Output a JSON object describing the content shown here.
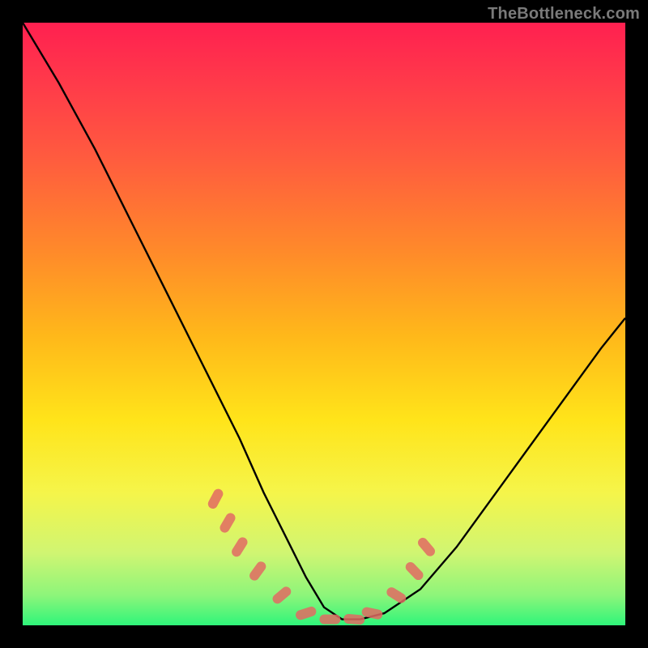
{
  "watermark": {
    "text": "TheBottleneck.com"
  },
  "chart_data": {
    "type": "line",
    "title": "",
    "xlabel": "",
    "ylabel": "",
    "xlim": [
      0,
      100
    ],
    "ylim": [
      0,
      100
    ],
    "grid": false,
    "legend": false,
    "series": [
      {
        "name": "bottleneck-curve",
        "x": [
          0,
          6,
          12,
          18,
          24,
          30,
          36,
          40,
          44,
          47,
          50,
          53,
          56,
          60,
          66,
          72,
          80,
          88,
          96,
          100
        ],
        "y": [
          100,
          90,
          79,
          67,
          55,
          43,
          31,
          22,
          14,
          8,
          3,
          1,
          1,
          2,
          6,
          13,
          24,
          35,
          46,
          51
        ]
      }
    ],
    "annotations": [
      {
        "type": "dash-segment",
        "x_center": 32,
        "y_center": 21,
        "angle_deg": -62
      },
      {
        "type": "dash-segment",
        "x_center": 34,
        "y_center": 17,
        "angle_deg": -60
      },
      {
        "type": "dash-segment",
        "x_center": 36,
        "y_center": 13,
        "angle_deg": -58
      },
      {
        "type": "dash-segment",
        "x_center": 39,
        "y_center": 9,
        "angle_deg": -54
      },
      {
        "type": "dash-segment",
        "x_center": 43,
        "y_center": 5,
        "angle_deg": -40
      },
      {
        "type": "dash-segment",
        "x_center": 47,
        "y_center": 2,
        "angle_deg": -18
      },
      {
        "type": "dash-segment",
        "x_center": 51,
        "y_center": 1,
        "angle_deg": 0
      },
      {
        "type": "dash-segment",
        "x_center": 55,
        "y_center": 1,
        "angle_deg": 5
      },
      {
        "type": "dash-segment",
        "x_center": 58,
        "y_center": 2,
        "angle_deg": 12
      },
      {
        "type": "dash-segment",
        "x_center": 62,
        "y_center": 5,
        "angle_deg": 32
      },
      {
        "type": "dash-segment",
        "x_center": 65,
        "y_center": 9,
        "angle_deg": 46
      },
      {
        "type": "dash-segment",
        "x_center": 67,
        "y_center": 13,
        "angle_deg": 50
      }
    ],
    "colors": {
      "curve": "#000000",
      "dash": "#e26a63",
      "background_top": "#ff2050",
      "background_bottom": "#2ff57a"
    }
  }
}
